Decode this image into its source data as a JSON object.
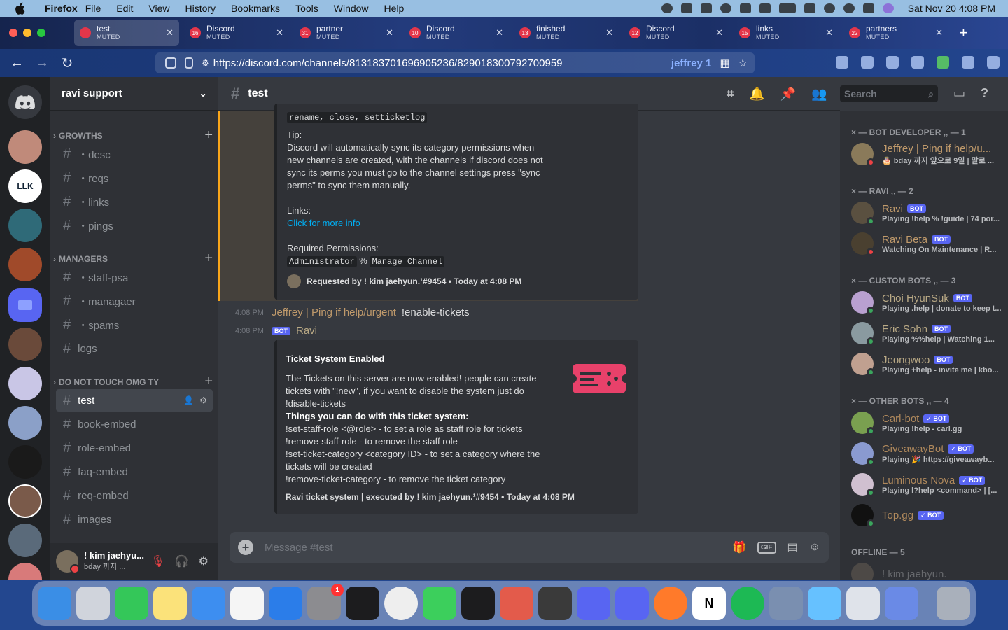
{
  "menubar": {
    "app_name": "Firefox",
    "items": [
      "File",
      "Edit",
      "View",
      "History",
      "Bookmarks",
      "Tools",
      "Window",
      "Help"
    ],
    "clock": "Sat Nov 20  4:08 PM"
  },
  "tabs": [
    {
      "title": "test",
      "sub": "MUTED",
      "badge": ""
    },
    {
      "title": "Discord",
      "sub": "MUTED",
      "badge": "16"
    },
    {
      "title": "partner",
      "sub": "MUTED",
      "badge": "31"
    },
    {
      "title": "Discord",
      "sub": "MUTED",
      "badge": "10"
    },
    {
      "title": "finished",
      "sub": "MUTED",
      "badge": "13"
    },
    {
      "title": "Discord",
      "sub": "MUTED",
      "badge": "12"
    },
    {
      "title": "links",
      "sub": "MUTED",
      "badge": "15"
    },
    {
      "title": "partners",
      "sub": "MUTED",
      "badge": "22"
    }
  ],
  "nav": {
    "url": "https://discord.com/channels/813183701696905236/829018300792700959",
    "profile_label": "jeffrey 1"
  },
  "server": {
    "name": "ravi support",
    "categories": [
      {
        "name": "GROWTHS"
      },
      {
        "name": "MANAGERS"
      },
      {
        "name": "DO NOT TOUCH OMG TY"
      }
    ],
    "channels": {
      "growths": [
        "・desc",
        "・reqs",
        "・links",
        "・pings"
      ],
      "managers": [
        "・staff-psa",
        "・managaer",
        "・spams",
        "logs"
      ],
      "other": [
        "test",
        "book-embed",
        "role-embed",
        "faq-embed",
        "req-embed",
        "images"
      ]
    }
  },
  "user": {
    "name": "! kim jaehyu...",
    "status": "bday 까지 ..."
  },
  "channel": {
    "name": "test",
    "search_placeholder": "Search",
    "composer_placeholder": "Message #test"
  },
  "embed1": {
    "top_code": "rename, close, setticketlog",
    "tip_title": "Tip:",
    "tip_lines": [
      "Discord will automatically sync its category permissions when",
      "new channels are created, with the channels if discord does not",
      "sync its perms you must go to the channel settings press \"sync",
      "perms\" to sync them manually."
    ],
    "links_title": "Links:",
    "link_text": "Click for more info",
    "perm_title": "Required Permissions:",
    "perm_a": "Administrator",
    "perm_sep": "%",
    "perm_b": "Manage Channel",
    "footer": "Requested by ! kim jaehyun.¹#9454  •  Today at 4:08 PM"
  },
  "messages": [
    {
      "time": "4:08 PM",
      "author": "Jeffrey | Ping if help/urgent",
      "content": "!enable-tickets"
    },
    {
      "time": "4:08 PM",
      "author": "Ravi",
      "bot": "BOT"
    }
  ],
  "embed2": {
    "title": "Ticket System Enabled",
    "lines": [
      "The Tickets on this server are now enabled! people can create",
      "tickets with \"!new\", if you want to disable the system just do",
      "!disable-tickets"
    ],
    "bold_line": "Things you can do with this ticket system:",
    "cmds": [
      "!set-staff-role <@role> - to set a role as staff role for tickets",
      "!remove-staff-role - to remove the staff role",
      "!set-ticket-category <category ID> - to set a category where the",
      "tickets will be created",
      "!remove-ticket-category - to remove the ticket category"
    ],
    "footer": "Ravi ticket system | executed by ! kim jaehyun.¹#9454  •  Today at 4:08 PM",
    "accent": "#e8416a"
  },
  "members": {
    "groups": [
      {
        "title": "× — BOT DEVELOPER ,, — 1"
      },
      {
        "title": "× — RAVI ,, — 2"
      },
      {
        "title": "× — CUSTOM BOTS ,, — 3"
      },
      {
        "title": "× — OTHER BOTS ,, — 4"
      },
      {
        "title": "OFFLINE — 5"
      }
    ],
    "list": [
      {
        "name": "Jeffrey | Ping if help/u...",
        "status": "🎂 bday 까지 앞으로 9일 | 말로 ...",
        "color": "#c09a6b",
        "bot": "",
        "dot": "#ed4245"
      },
      {
        "name": "Ravi",
        "status": "Playing !help % !guide | 74 por...",
        "color": "#c09a6b",
        "bot": "BOT",
        "dot": "#3ba55d"
      },
      {
        "name": "Ravi Beta",
        "status": "Watching On Maintenance | R...",
        "color": "#c09a6b",
        "bot": "BOT",
        "dot": "#ed4245"
      },
      {
        "name": "Choi HyunSuk",
        "status": "Playing .help | donate to keep t...",
        "color": "#b9a985",
        "bot": "BOT",
        "dot": "#3ba55d"
      },
      {
        "name": "Eric Sohn",
        "status": "Playing %%help | Watching 1...",
        "color": "#b9a985",
        "bot": "BOT",
        "dot": "#3ba55d"
      },
      {
        "name": "Jeongwoo",
        "status": "Playing +help - invite me | kbo...",
        "color": "#b9a985",
        "bot": "BOT",
        "dot": "#3ba55d"
      },
      {
        "name": "Carl-bot",
        "status": "Playing !help - carl.gg",
        "color": "#b0895c",
        "bot": "✓ BOT",
        "dot": "#3ba55d"
      },
      {
        "name": "GiveawayBot",
        "status": "Playing 🎉 https://giveawayb...",
        "color": "#b0895c",
        "bot": "✓ BOT",
        "dot": "#3ba55d"
      },
      {
        "name": "Luminous Nova",
        "status": "Playing l?help <command> | [...",
        "color": "#b0895c",
        "bot": "✓ BOT",
        "dot": "#3ba55d"
      },
      {
        "name": "Top.gg",
        "status": "",
        "color": "#b0895c",
        "bot": "✓ BOT",
        "dot": "#3ba55d"
      },
      {
        "name": "! kim jaehyun.",
        "status": "",
        "color": "#72767d",
        "bot": "",
        "dot": ""
      }
    ]
  },
  "dock": [
    "Finder",
    "Launchpad",
    "Messages",
    "Notes",
    "Mail",
    "Photos",
    "App Store",
    "System Preferences",
    "Activity Monitor",
    "Chrome",
    "FaceTime",
    "Terminal",
    "Brave",
    "Preview",
    "Discord",
    "Discord PTB",
    "Firefox",
    "Notion",
    "Spotify",
    "Xcode Tools",
    "Safari",
    "Jira",
    "Remote",
    "Trash"
  ]
}
